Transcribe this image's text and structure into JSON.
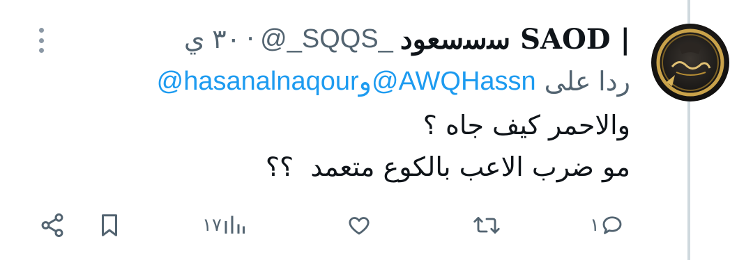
{
  "tweet": {
    "author": {
      "display_name": "ﺳﺳﺳﻌﻮد SAOD |",
      "handle": "@_SQQS_",
      "time": "٣٠ ي"
    },
    "reply": {
      "label": "ردا على",
      "mentions": [
        "@AWQHassn",
        "@hasanalnaqour"
      ],
      "joiner": "و"
    },
    "text_lines": [
      "والاحمر كيف جاه ؟",
      "مو ضرب الاعب بالكوع متعمد  ؟؟"
    ],
    "actions": {
      "reply_count": "١",
      "retweet_count": "",
      "like_count": "",
      "views_count": "١٧"
    },
    "icons": {
      "more": "more-vertical-icon",
      "reply": "comment-icon",
      "retweet": "retweet-icon",
      "like": "heart-icon",
      "views": "analytics-bars-icon",
      "bookmark": "bookmark-icon",
      "share": "share-icon"
    },
    "colors": {
      "text": "#0f1419",
      "secondary": "#536471",
      "link": "#1d9bf0",
      "divider": "#cfd9de"
    }
  }
}
